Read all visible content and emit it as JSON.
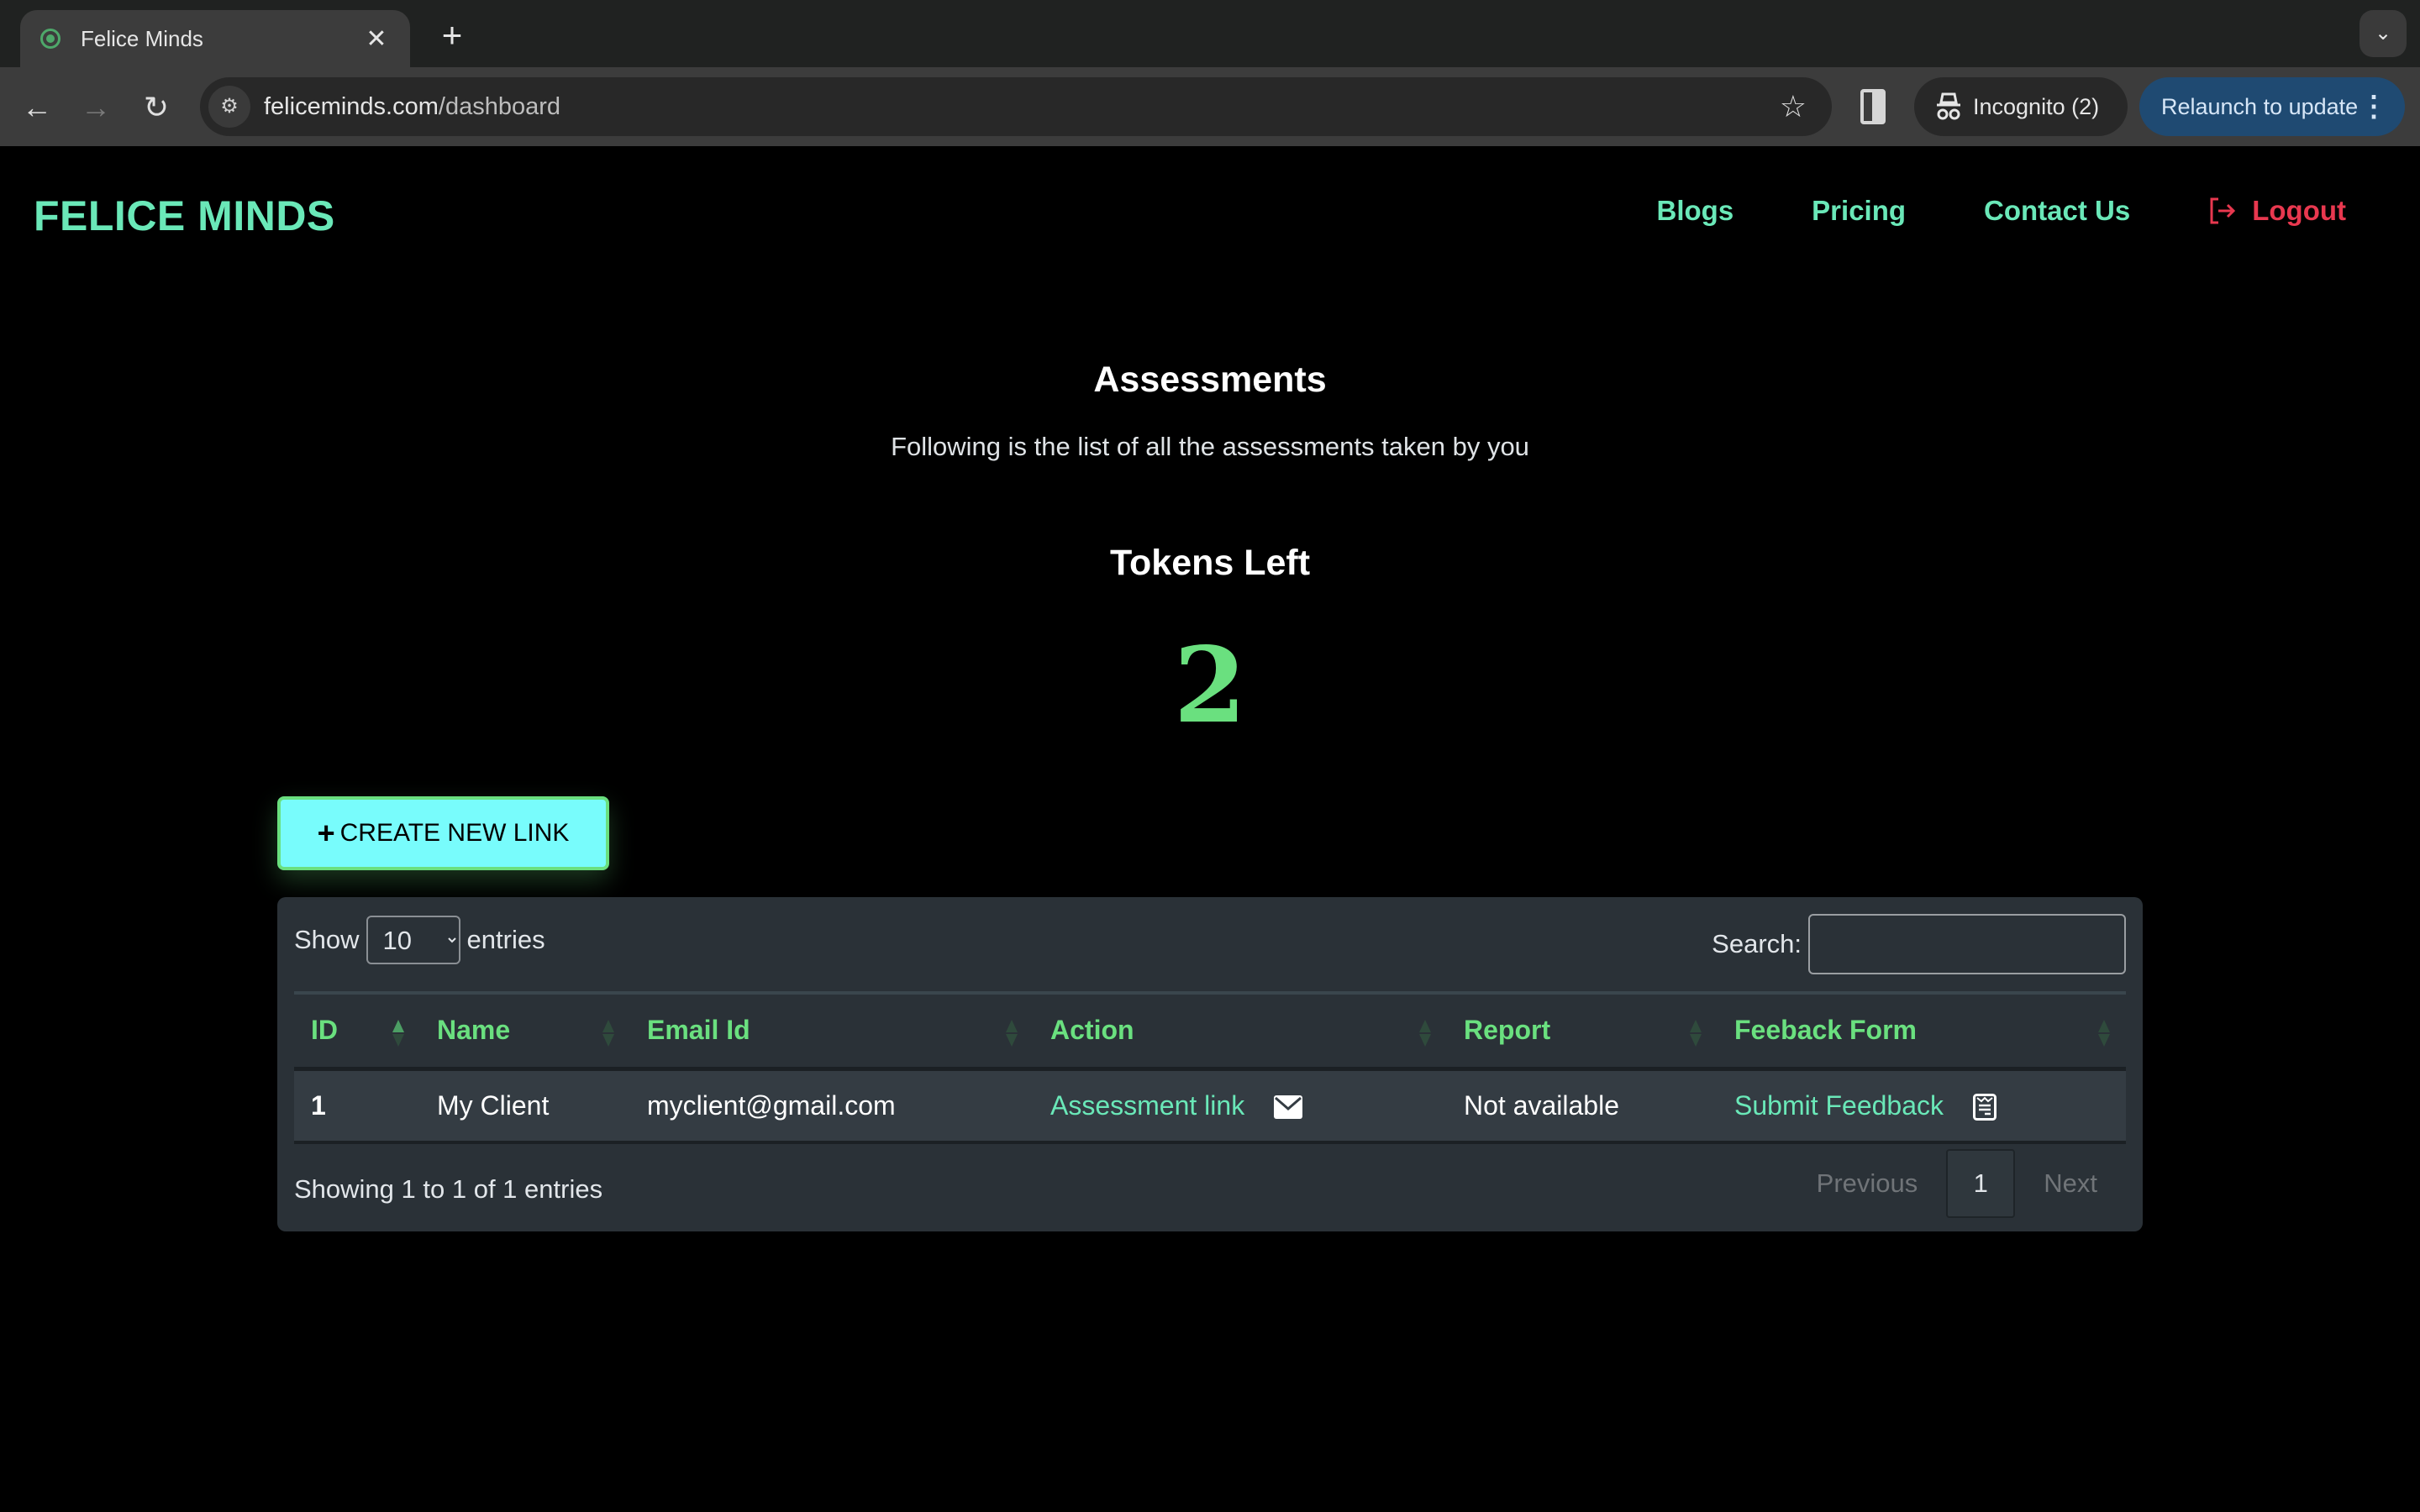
{
  "browser": {
    "tab_title": "Felice Minds",
    "url_host": "feliceminds.com",
    "url_path": "/dashboard",
    "incognito_label": "Incognito (2)",
    "relaunch_label": "Relaunch to update"
  },
  "header": {
    "brand": "FELICE MINDS",
    "nav": [
      "Blogs",
      "Pricing",
      "Contact Us"
    ],
    "logout": "Logout"
  },
  "main": {
    "title": "Assessments",
    "subtitle": "Following is the list of all the assessments taken by you",
    "tokens_title": "Tokens Left",
    "tokens_value": "2",
    "create_button": "CREATE NEW LINK"
  },
  "table": {
    "length_label_pre": "Show",
    "length_value": "10",
    "length_label_post": "entries",
    "search_label": "Search:",
    "search_value": "",
    "columns": [
      "ID",
      "Name",
      "Email Id",
      "Action",
      "Report",
      "Feeback Form"
    ],
    "rows": [
      {
        "id": "1",
        "name": "My Client",
        "email": "myclient@gmail.com",
        "action": "Assessment link",
        "report": "Not available",
        "feedback": "Submit Feedback"
      }
    ],
    "info": "Showing 1 to 1 of 1 entries",
    "pagination": {
      "previous": "Previous",
      "current": "1",
      "next": "Next"
    }
  },
  "colors": {
    "brand": "#6ae8b8",
    "accent_green": "#6ae07f",
    "logout": "#e8384f",
    "button_bg": "#78fcfc",
    "card_bg": "#2a3137"
  }
}
